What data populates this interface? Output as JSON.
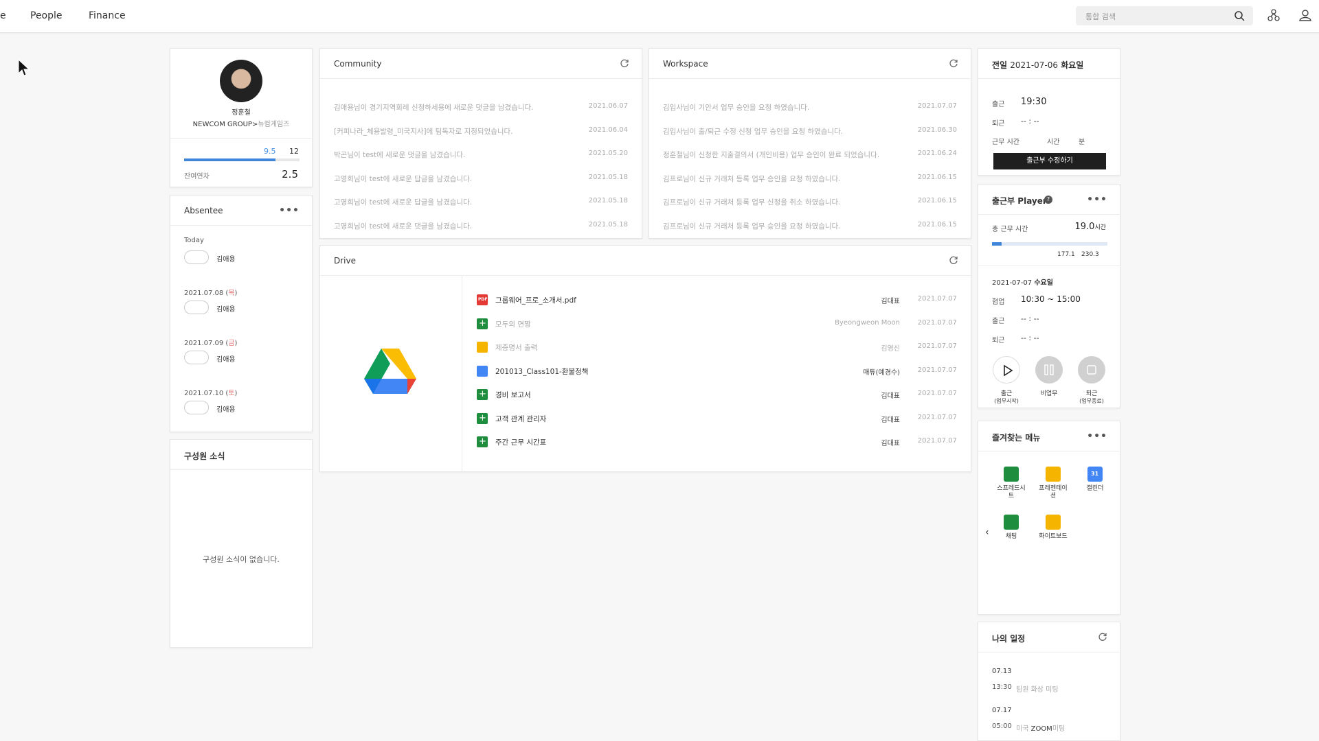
{
  "nav": {
    "partial": "e",
    "people": "People",
    "finance": "Finance"
  },
  "search": {
    "placeholder": "통합 검색"
  },
  "profile": {
    "name": "정훈철",
    "org": "NEWCOM GROUP>",
    "dept": "뉴컴게임즈",
    "used": "9.5",
    "total": "12",
    "used_fraction": 0.792,
    "remain_label": "잔여연차",
    "remain": "2.5"
  },
  "absentee": {
    "title": "Absentee",
    "groups": [
      {
        "label": "Today",
        "status": "",
        "name": "김애용"
      },
      {
        "label": "2021.07.08 (",
        "day": "목",
        "close": ")",
        "status": "",
        "name": "김애용"
      },
      {
        "label": "2021.07.09 (",
        "day": "금",
        "close": ")",
        "status": "",
        "name": "김애용"
      },
      {
        "label": "2021.07.10 (",
        "day": "토",
        "close": ")",
        "status": "",
        "name": "김애용"
      }
    ]
  },
  "news": {
    "title": "구성원 소식",
    "empty": "구성원 소식이 없습니다."
  },
  "community": {
    "title": "Community",
    "rows": [
      {
        "text": "김애용님이 경기지역회례 신청하세용에 새로운 댓글을 남겼습니다.",
        "date": "2021.06.07"
      },
      {
        "text": "[커피나라_체용발령_미국지사]에 팀독자로 지정되었습니다.",
        "date": "2021.06.04"
      },
      {
        "text": "박곤님이 test에 새로운 댓글을 남겼습니다.",
        "date": "2021.05.20"
      },
      {
        "text": "고영희님이 test에 새로운 답글을 남겼습니다.",
        "date": "2021.05.18"
      },
      {
        "text": "고영희님이 test에 새로운 답글을 남겼습니다.",
        "date": "2021.05.18"
      },
      {
        "text": "고영희님이 test에 새로운 댓글을 남겼습니다.",
        "date": "2021.05.18"
      }
    ]
  },
  "workspace": {
    "title": "Workspace",
    "rows": [
      {
        "text": "김입사님이 기안서 업무 승인을 요청 하였습니다.",
        "date": "2021.07.07"
      },
      {
        "text": "김입사님이 출/퇴근 수정 신청 업무 승인을 요청 하였습니다.",
        "date": "2021.06.30"
      },
      {
        "text": "정훈철님이 신청한 지출결의서 (개인비용) 업무 승인이 완료 되었습니다.",
        "date": "2021.06.24"
      },
      {
        "text": "김프로님이 신규 거래처 등록 업무 승인을 요청 하였습니다.",
        "date": "2021.06.15"
      },
      {
        "text": "김프로님이 신규 거래처 등록 업무 신청을 취소 하였습니다.",
        "date": "2021.06.15"
      },
      {
        "text": "김프로님이 신규 거래처 등록 업무 승인을 요청 하였습니다.",
        "date": "2021.06.15"
      }
    ]
  },
  "drive": {
    "title": "Drive",
    "files": [
      {
        "name": "그룹웨어_프로_소개서.pdf",
        "owner": "김대표",
        "date": "2021.07.07",
        "type": "pdf",
        "color": "#e53935",
        "dim": false
      },
      {
        "name": "모두의 면짱",
        "owner": "Byeongweon Moon",
        "date": "2021.07.07",
        "type": "sheet",
        "color": "#1e8e3e",
        "dim": true
      },
      {
        "name": "제증명서 출력",
        "owner": "김영신",
        "date": "2021.07.07",
        "type": "slide",
        "color": "#f4b400",
        "dim": true
      },
      {
        "name": "201013_Class101-환불정책",
        "owner": "매튜(예경수)",
        "date": "2021.07.07",
        "type": "doc",
        "color": "#4285f4",
        "dim": false
      },
      {
        "name": "경비 보고서",
        "owner": "김대표",
        "date": "2021.07.07",
        "type": "sheet",
        "color": "#1e8e3e",
        "dim": false
      },
      {
        "name": "고객 관계 관리자",
        "owner": "김대표",
        "date": "2021.07.07",
        "type": "sheet",
        "color": "#1e8e3e",
        "dim": false
      },
      {
        "name": "주간 근무 시간표",
        "owner": "김대표",
        "date": "2021.07.07",
        "type": "sheet",
        "color": "#1e8e3e",
        "dim": false
      }
    ]
  },
  "prevday": {
    "title_prefix": "전일",
    "title_date": "2021-07-06",
    "title_day": "화요일",
    "in_label": "출근",
    "in_value": "19:30",
    "out_label": "퇴근",
    "out_value": "-- : --",
    "work_label": "근무 시간",
    "hour_unit": "시간",
    "min_unit": "분",
    "edit_button": "출근부 수정하기"
  },
  "player": {
    "title": "출근부 Player",
    "total_label": "총 근무 시간",
    "total_value": "19.0",
    "total_unit": "시간",
    "progress_fraction": 0.082,
    "mark1": "177.1",
    "mark2": "230.3",
    "date": "2021-07-07",
    "day": "수요일",
    "collab_label": "협업",
    "collab_value": "10:30 ~ 15:00",
    "in_label": "출근",
    "in_value": "-- : --",
    "out_label": "퇴근",
    "out_value": "-- : --",
    "btn_start": "출근",
    "btn_start_sub": "(업무시작)",
    "btn_pause": "비업무",
    "btn_stop": "퇴근",
    "btn_stop_sub": "(업무종료)"
  },
  "favorites": {
    "title": "즐겨찾는 메뉴",
    "apps": [
      {
        "line1": "스프레드시",
        "line2": "트",
        "color": "#1e8e3e"
      },
      {
        "line1": "프레젠테이",
        "line2": "션",
        "color": "#f4b400"
      },
      {
        "line1": "캘린더",
        "line2": "",
        "color": "#4285f4",
        "badge": "31"
      },
      {
        "line1": "채팅",
        "line2": "",
        "color": "#1e8e3e"
      },
      {
        "line1": "화이트보드",
        "line2": "",
        "color": "#f4b400"
      }
    ]
  },
  "schedule": {
    "title": "나의 일정",
    "items": [
      {
        "date": "07.13",
        "time": "13:30",
        "text": "팀원 화상 미팅",
        "text_b": ""
      },
      {
        "date": "07.17",
        "time": "05:00",
        "text": "미국 ",
        "text_b": "ZOOM",
        "text_c": "미팅"
      }
    ]
  }
}
